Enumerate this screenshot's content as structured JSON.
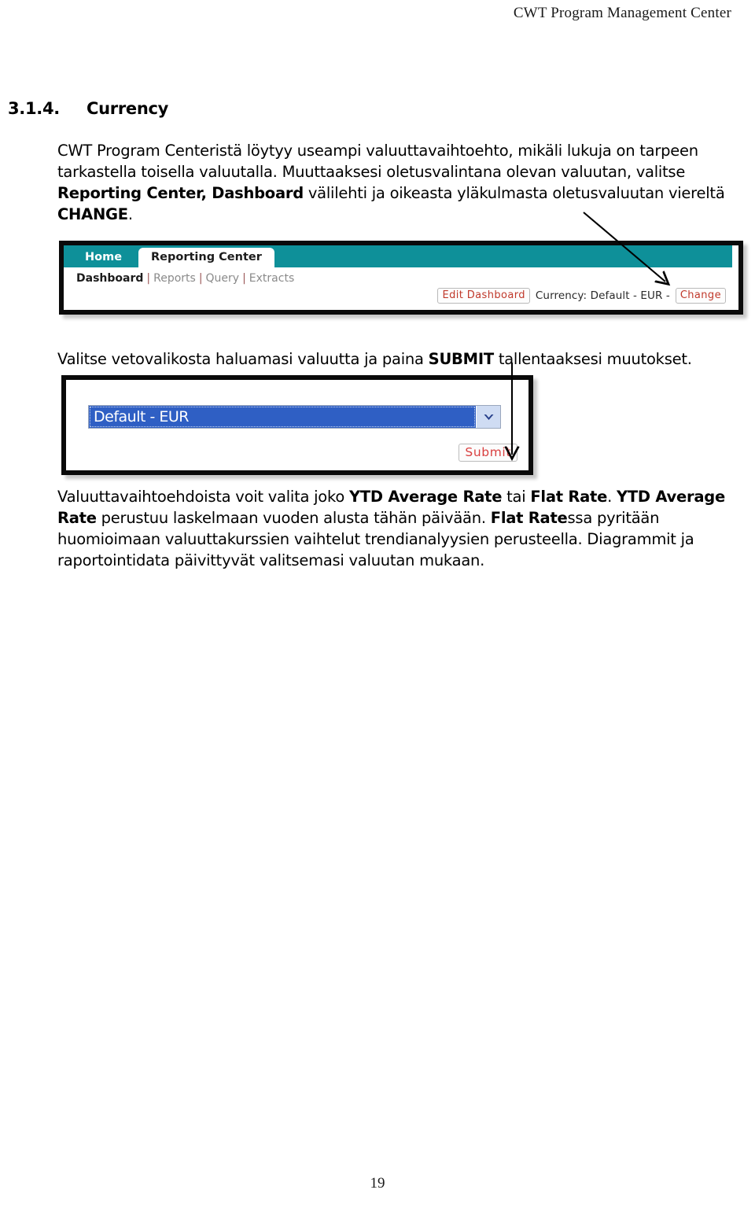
{
  "document": {
    "running_header": "CWT Program Management Center",
    "page_number": "19"
  },
  "heading": {
    "number": "3.1.4.",
    "title": "Currency"
  },
  "paragraphs": {
    "intro": {
      "line1": "CWT Program Centeristä löytyy useampi valuuttavaihtoehto, mikäli lukuja on tarpeen",
      "line2": "tarkastella toisella valuutalla.",
      "line3_a": "Muuttaaksesi oletusvalintana olevan valuutan, valitse ",
      "line3_b": "Reporting Center, Dashboard",
      "line4_a": "välilehti ja oikeasta yläkulmasta oletusvaluutan viereltä ",
      "line4_b": "CHANGE",
      "line4_c": "."
    },
    "select_instruction": {
      "a": "Valitse vetovalikosta haluamasi valuutta ja paina ",
      "b": "SUBMIT",
      "c": " tallentaaksesi muutokset."
    },
    "rates": {
      "l1_a": "Valuuttavaihtoehdoista voit valita joko ",
      "l1_b": "YTD Average Rate",
      "l1_c": " tai ",
      "l1_d": "Flat Rate",
      "l1_e": ".",
      "l2_a": "YTD Average Rate",
      "l2_b": " perustuu laskelmaan vuoden alusta tähän päivään.",
      "l3_a": "Flat Rate",
      "l3_b": "ssa pyritään huomioimaan valuuttakurssien vaihtelut trendianalyysien",
      "l4": "perusteella.",
      "l5": "Diagrammit ja raportointidata päivittyvät valitsemasi valuutan mukaan."
    }
  },
  "screenshot_nav": {
    "tabs": {
      "home": "Home",
      "reporting_center": "Reporting Center"
    },
    "subnav": {
      "dashboard": "Dashboard",
      "reports": "Reports",
      "query": "Query",
      "extracts": "Extracts",
      "separator": "|"
    },
    "toolbar": {
      "edit_dashboard": "Edit Dashboard",
      "currency_label": "Currency: Default - EUR  -",
      "change": "Change"
    },
    "colors": {
      "navbar_teal": "#0e9099",
      "button_text_red": "#c0392b"
    }
  },
  "screenshot_dropdown": {
    "select_value": "Default - EUR",
    "submit": "Submit",
    "colors": {
      "selection_blue": "#2f5fc4",
      "arrow_button": "#cfdcf3",
      "submit_text_red": "#d93f3f"
    }
  }
}
